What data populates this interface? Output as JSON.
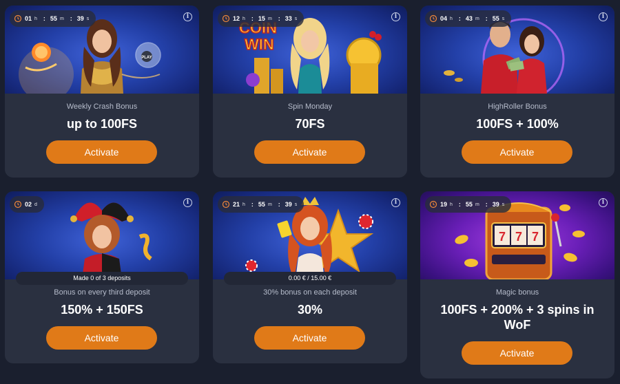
{
  "cards": [
    {
      "timer": {
        "h": "01",
        "m": "55",
        "s": "39"
      },
      "title": "Weekly Crash Bonus",
      "amount": "up to 100FS",
      "button": "Activate",
      "art_text": "PLAY"
    },
    {
      "timer": {
        "h": "12",
        "m": "15",
        "s": "33"
      },
      "title": "Spin Monday",
      "amount": "70FS",
      "button": "Activate",
      "art_text_1": "COIN",
      "art_text_2": "WIN"
    },
    {
      "timer": {
        "h": "04",
        "m": "43",
        "s": "55"
      },
      "title": "HighRoller Bonus",
      "amount": "100FS + 100%",
      "button": "Activate"
    },
    {
      "timer": {
        "d": "02"
      },
      "progress": "Made 0 of 3 deposits",
      "title": "Bonus on every third deposit",
      "amount": "150% + 150FS",
      "button": "Activate"
    },
    {
      "timer": {
        "h": "21",
        "m": "55",
        "s": "39"
      },
      "progress": "0.00 € / 15.00 €",
      "title": "30% bonus on each deposit",
      "amount": "30%",
      "button": "Activate"
    },
    {
      "timer": {
        "h": "19",
        "m": "55",
        "s": "39"
      },
      "title": "Magic bonus",
      "amount": "100FS + 200% + 3 spins in WoF",
      "button": "Activate"
    }
  ],
  "units": {
    "h": "h",
    "m": "m",
    "s": "s",
    "d": "d"
  },
  "colors": {
    "page_bg": "#1a1f2e",
    "card_bg": "#2a3040",
    "button": "#e07a18",
    "subtitle": "#b6bccb"
  },
  "icons": {
    "timer": "clock-icon",
    "info": "info-icon"
  }
}
